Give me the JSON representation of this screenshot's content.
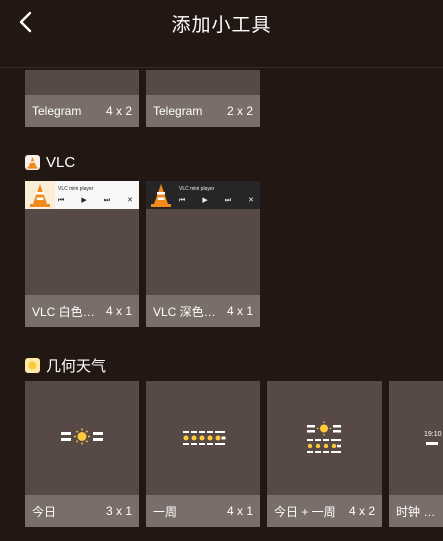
{
  "header": {
    "title": "添加小工具"
  },
  "telegram": {
    "widgets": [
      {
        "name": "Telegram",
        "size": "4 x 2"
      },
      {
        "name": "Telegram",
        "size": "2 x 2"
      }
    ]
  },
  "vlc": {
    "app_name": "VLC",
    "widgets": [
      {
        "name": "VLC 白色小…",
        "size": "4 x 1",
        "player_title": "VLC mini player"
      },
      {
        "name": "VLC 深色小…",
        "size": "4 x 1",
        "player_title": "VLC mini player"
      }
    ],
    "controls": {
      "prev": "⏮",
      "play": "▶",
      "next": "⏭",
      "close": "✕"
    }
  },
  "weather": {
    "app_name": "几何天气",
    "widgets": [
      {
        "name": "今日",
        "size": "3 x 1"
      },
      {
        "name": "一周",
        "size": "4 x 1"
      },
      {
        "name": "今日 + 一周",
        "size": "4 x 2"
      },
      {
        "name": "时钟 + 今",
        "size": "",
        "preview_time": "19:10"
      }
    ]
  },
  "colors": {
    "background": "#231714",
    "card": "#574a46",
    "card_footer": "#7a6e6a",
    "vlc_orange": "#f08a1c",
    "sun_yellow": "#ffc93c"
  }
}
